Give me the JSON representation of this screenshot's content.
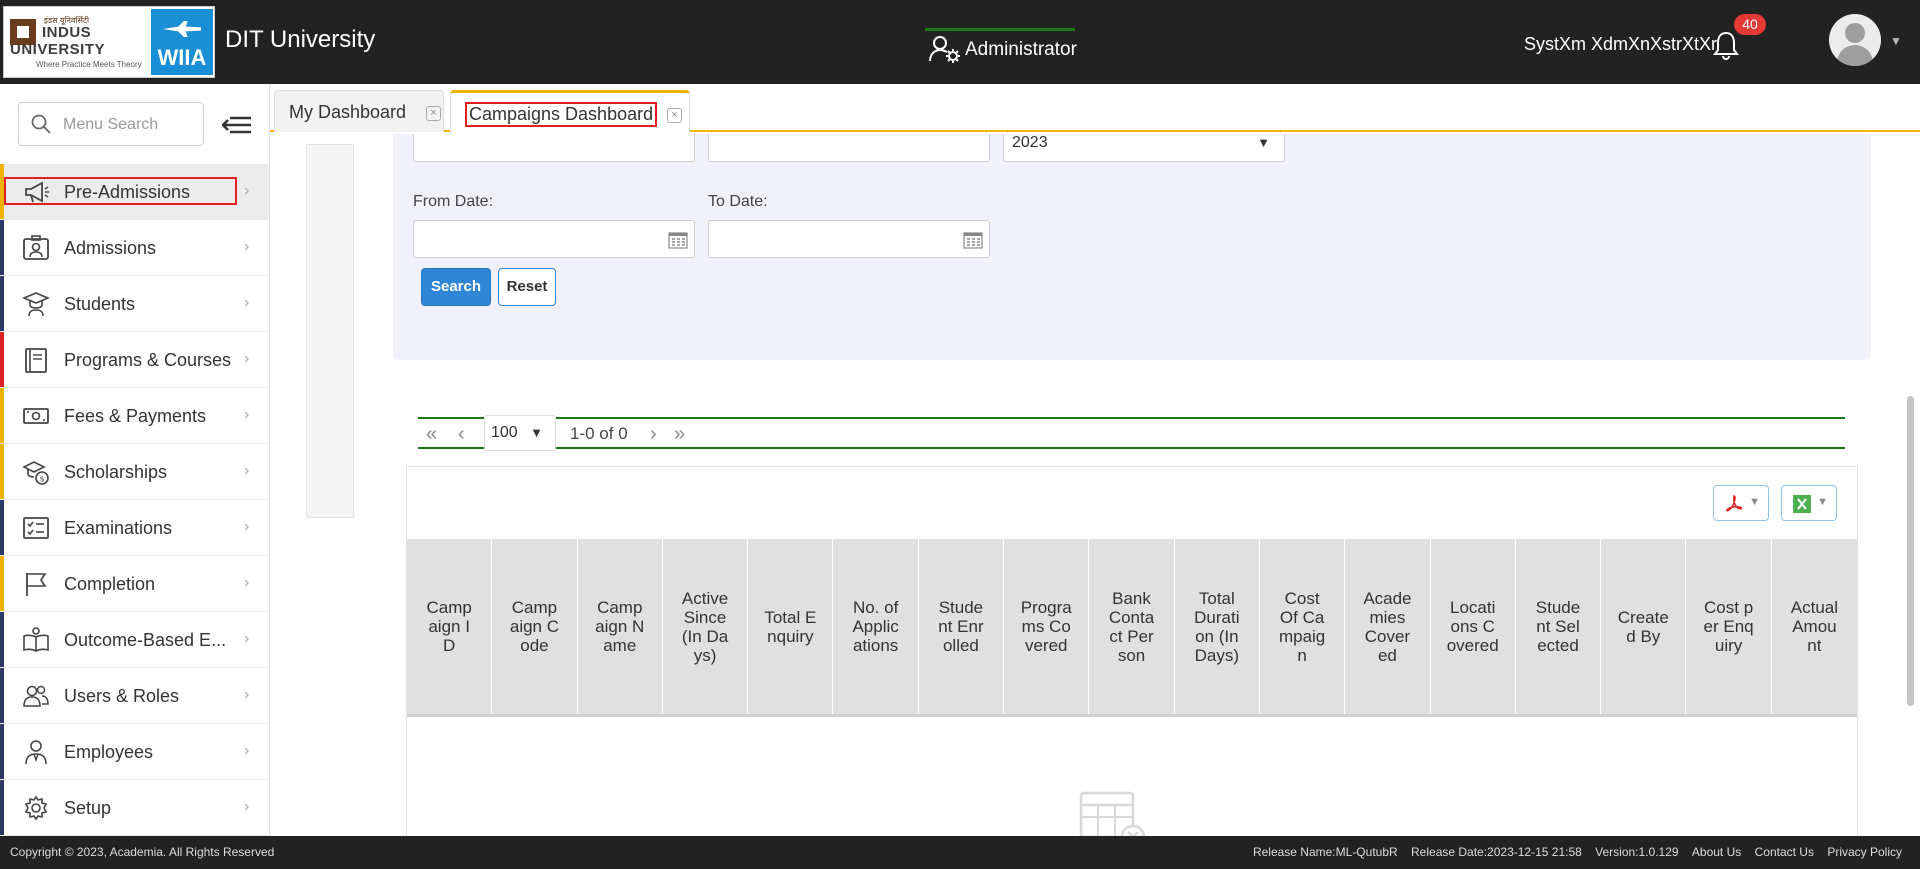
{
  "header": {
    "logo_indus_hindi": "इंडस यूनिवर्सिटी",
    "logo_indus_line1": "INDUS",
    "logo_indus_line2": "UNIVERSITY",
    "logo_indus_tagline": "Where Practice Meets Theory",
    "logo_wiia_text": "WIIA",
    "app_title": "DIT University",
    "role": "Administrator",
    "user_name": "SystXm XdmXnXstrXtXr",
    "notification_count": "40",
    "avatar_icon": "user-avatar-icon"
  },
  "sidebar": {
    "search_placeholder": "Menu Search",
    "items": [
      {
        "label": "Pre-Admissions",
        "icon": "megaphone-icon",
        "accent": "#f0b400"
      },
      {
        "label": "Admissions",
        "icon": "id-card-icon",
        "accent": "#2b3a67"
      },
      {
        "label": "Students",
        "icon": "graduation-cap-icon",
        "accent": "#2b3a67"
      },
      {
        "label": "Programs & Courses",
        "icon": "book-icon",
        "accent": "#e02020"
      },
      {
        "label": "Fees & Payments",
        "icon": "money-icon",
        "accent": "#f0b400"
      },
      {
        "label": "Scholarships",
        "icon": "scholarship-icon",
        "accent": "#f0b400"
      },
      {
        "label": "Examinations",
        "icon": "checklist-icon",
        "accent": "#2b3a67"
      },
      {
        "label": "Completion",
        "icon": "flag-icon",
        "accent": "#f0b400"
      },
      {
        "label": "Outcome-Based E...",
        "icon": "open-book-icon",
        "accent": "#2b3a67"
      },
      {
        "label": "Users & Roles",
        "icon": "users-icon",
        "accent": "#2b3a67"
      },
      {
        "label": "Employees",
        "icon": "employee-icon",
        "accent": "#2b3a67"
      },
      {
        "label": "Setup",
        "icon": "gear-icon",
        "accent": "#2b3a67"
      }
    ]
  },
  "tabs": [
    {
      "label": "My Dashboard"
    },
    {
      "label": "Campaigns Dashboard"
    }
  ],
  "filters": {
    "year_value": "2023",
    "from_date_label": "From Date:",
    "to_date_label": "To Date:",
    "from_date_value": "",
    "to_date_value": "",
    "search_label": "Search",
    "reset_label": "Reset"
  },
  "pager": {
    "page_size": "100",
    "info": "1-0 of 0"
  },
  "grid": {
    "columns": [
      "Campaign ID",
      "Campaign Code",
      "Campaign Name",
      "Active Since (In Days)",
      "Total Enquiry",
      "No. of Applications",
      "Student Enrolled",
      "Programs Covered",
      "Bank Contact Person",
      "Total Duration (In Days)",
      "Cost Of Campaign",
      "Academies Covered",
      "Locations Covered",
      "Student Selected",
      "Created By",
      "Cost per Enquiry",
      "Actual Amount"
    ]
  },
  "footer": {
    "copyright": "Copyright © 2023, Academia. All Rights Reserved",
    "release_name": "Release Name:ML-QutubR",
    "release_date": "Release Date:2023-12-15 21:58",
    "version": "Version:1.0.129",
    "about": "About Us",
    "contact": "Contact Us",
    "privacy": "Privacy Policy"
  },
  "colors": {
    "header_bg": "#222222",
    "accent_yellow": "#f0b400",
    "primary_blue": "#2f86d6",
    "highlight_red": "#e02020",
    "pager_green": "#1a7a1a",
    "notification_red": "#e53935"
  }
}
